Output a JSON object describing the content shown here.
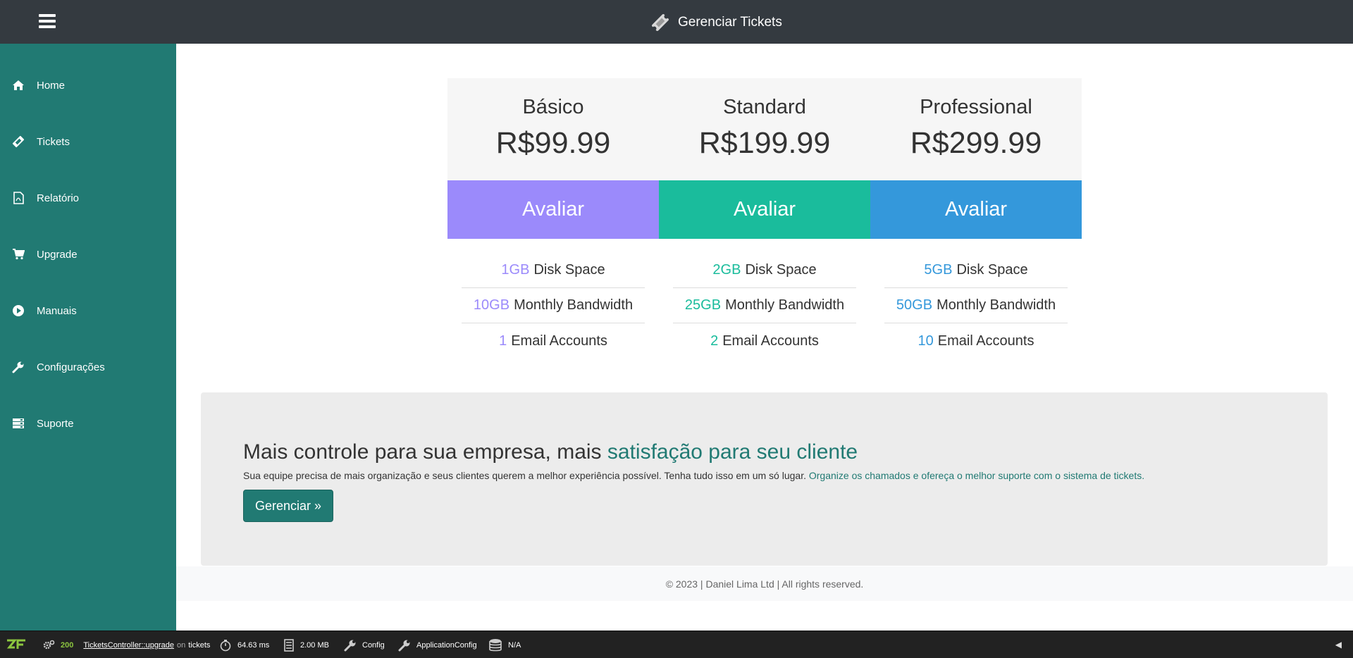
{
  "header": {
    "title": "Gerenciar Tickets",
    "brand_icon": "ticket-icon",
    "menu_icon": "hamburger-menu-icon"
  },
  "sidebar": {
    "items": [
      {
        "label": "Home",
        "icon": "home-icon"
      },
      {
        "label": "Tickets",
        "icon": "ticket-icon"
      },
      {
        "label": "Relatório",
        "icon": "pdf-file-icon"
      },
      {
        "label": "Upgrade",
        "icon": "cart-icon"
      },
      {
        "label": "Manuais",
        "icon": "play-circle-icon"
      },
      {
        "label": "Configurações",
        "icon": "wrench-icon"
      },
      {
        "label": "Suporte",
        "icon": "server-icon"
      }
    ]
  },
  "plans": [
    {
      "name": "Básico",
      "price": "R$99.99",
      "button": "Avaliar",
      "color": "#9b8afb",
      "features": [
        {
          "value": "1GB",
          "label": "Disk Space"
        },
        {
          "value": "10GB",
          "label": "Monthly Bandwidth"
        },
        {
          "value": "1",
          "label": "Email Accounts"
        }
      ]
    },
    {
      "name": "Standard",
      "price": "R$199.99",
      "button": "Avaliar",
      "color": "#1abc9c",
      "features": [
        {
          "value": "2GB",
          "label": "Disk Space"
        },
        {
          "value": "25GB",
          "label": "Monthly Bandwidth"
        },
        {
          "value": "2",
          "label": "Email Accounts"
        }
      ]
    },
    {
      "name": "Professional",
      "price": "R$299.99",
      "button": "Avaliar",
      "color": "#3498db",
      "features": [
        {
          "value": "5GB",
          "label": "Disk Space"
        },
        {
          "value": "50GB",
          "label": "Monthly Bandwidth"
        },
        {
          "value": "10",
          "label": "Email Accounts"
        }
      ]
    }
  ],
  "promo": {
    "title_plain": "Mais controle para sua empresa, mais ",
    "title_accent": "satisfação para seu cliente",
    "text_plain": "Sua equipe precisa de mais organização e seus clientes querem a melhor experiência possível. Tenha tudo isso em um só lugar. ",
    "text_accent": "Organize os chamados e ofereça o melhor suporte com o sistema de tickets.",
    "button": "Gerenciar »"
  },
  "footer": {
    "text": "© 2023 | Daniel Lima Ltd | All rights reserved."
  },
  "debug_toolbar": {
    "status": "200",
    "route": "TicketsController::upgrade",
    "on_word": "on",
    "route_name": "tickets",
    "time": "64.63 ms",
    "memory": "2.00 MB",
    "config": "Config",
    "app_config": "ApplicationConfig",
    "db": "N/A",
    "toggle": "◀"
  },
  "colors": {
    "topbar": "#343a40",
    "sidebar": "#217a73",
    "accent": "#217a73"
  }
}
